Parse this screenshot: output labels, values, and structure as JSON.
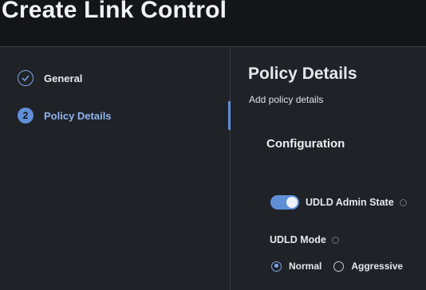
{
  "page": {
    "title": "Create Link Control"
  },
  "wizard": {
    "steps": [
      {
        "label": "General",
        "status": "completed",
        "icon": "check-icon"
      },
      {
        "label": "Policy Details",
        "number": "2",
        "status": "current"
      }
    ]
  },
  "policy_details": {
    "title": "Policy Details",
    "subtitle": "Add policy details",
    "configuration_title": "Configuration",
    "udld_admin_state": {
      "label": "UDLD Admin State",
      "enabled": true
    },
    "udld_mode": {
      "label": "UDLD Mode",
      "options": [
        "Normal",
        "Aggressive"
      ],
      "selected": "Normal"
    }
  },
  "colors": {
    "accent": "#5f8fd6",
    "background": "#131519",
    "panel": "#1f2227"
  }
}
